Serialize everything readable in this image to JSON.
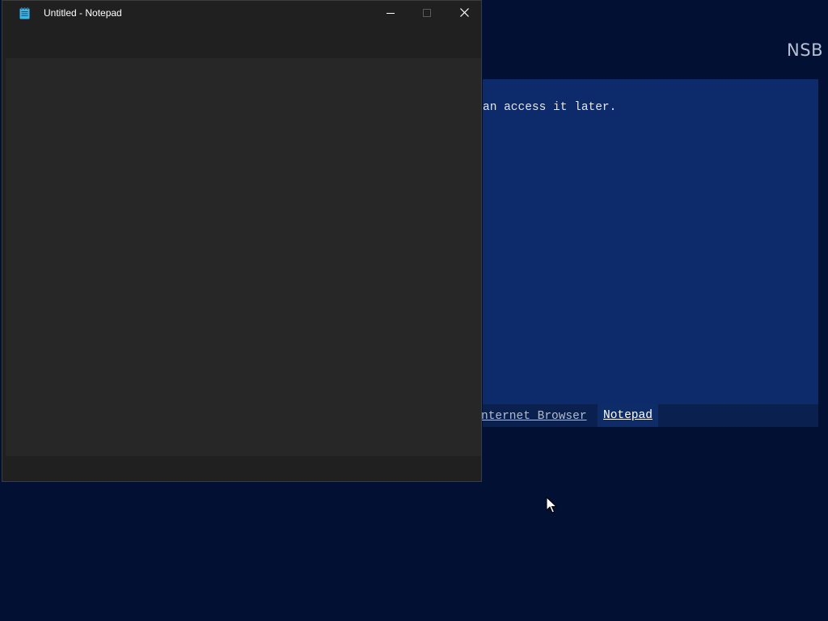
{
  "background_app": {
    "brand": "NSB",
    "panel_text": "an access it later.",
    "tabs": [
      {
        "label": "nternet Browser",
        "active": false
      },
      {
        "label": "Notepad",
        "active": true
      }
    ]
  },
  "notepad": {
    "title": "Untitled - Notepad",
    "content": "",
    "controls": {
      "minimize": "minimize-icon",
      "maximize": "maximize-icon",
      "close": "close-icon"
    }
  },
  "colors": {
    "desktop_bg": "#021034",
    "panel_bg": "#0d2b6a",
    "window_bg": "#202020",
    "editor_bg": "#272727",
    "app_icon": "#3fb4e6"
  }
}
